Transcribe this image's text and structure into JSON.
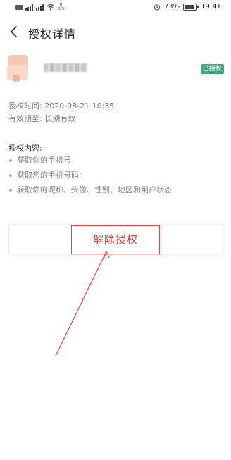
{
  "status_bar": {
    "net_speed": "0\nK/s",
    "battery": "73%",
    "time": "19:41"
  },
  "nav": {
    "title": "授权详情",
    "back_icon": "chevron-left-icon"
  },
  "app": {
    "status_badge": "已授权"
  },
  "auth_info": {
    "time_label": "授权时间: 2020-08-21 10:35",
    "validity_label": "有效期至: 长期有效"
  },
  "permissions": {
    "title": "授权内容:",
    "items": [
      "获取你的手机号",
      "获取您的手机号码;",
      "获取你的昵称、头像、性别、地区和用户状态"
    ]
  },
  "actions": {
    "revoke_label": "解除授权"
  },
  "colors": {
    "badge": "#3aaa86",
    "revoke_text": "#c43c3c",
    "annotation": "#e14444"
  }
}
